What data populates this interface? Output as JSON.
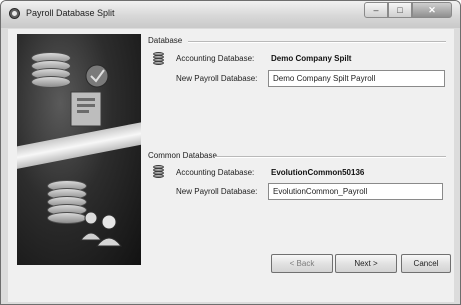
{
  "window": {
    "title": "Payroll Database Split",
    "controls": {
      "minimize": "–",
      "maximize": "□",
      "close": "✕"
    }
  },
  "database_section": {
    "label": "Database",
    "accounting_label": "Accounting Database:",
    "accounting_value": "Demo Company Spilt",
    "new_payroll_label": "New Payroll Database:",
    "new_payroll_value": "Demo Company Spilt Payroll"
  },
  "common_section": {
    "label": "Common Database",
    "accounting_label": "Accounting Database:",
    "accounting_value": "EvolutionCommon50136",
    "new_payroll_label": "New Payroll Database:",
    "new_payroll_value": "EvolutionCommon_Payroll"
  },
  "buttons": {
    "back": "< Back",
    "next": "Next >",
    "cancel": "Cancel"
  }
}
